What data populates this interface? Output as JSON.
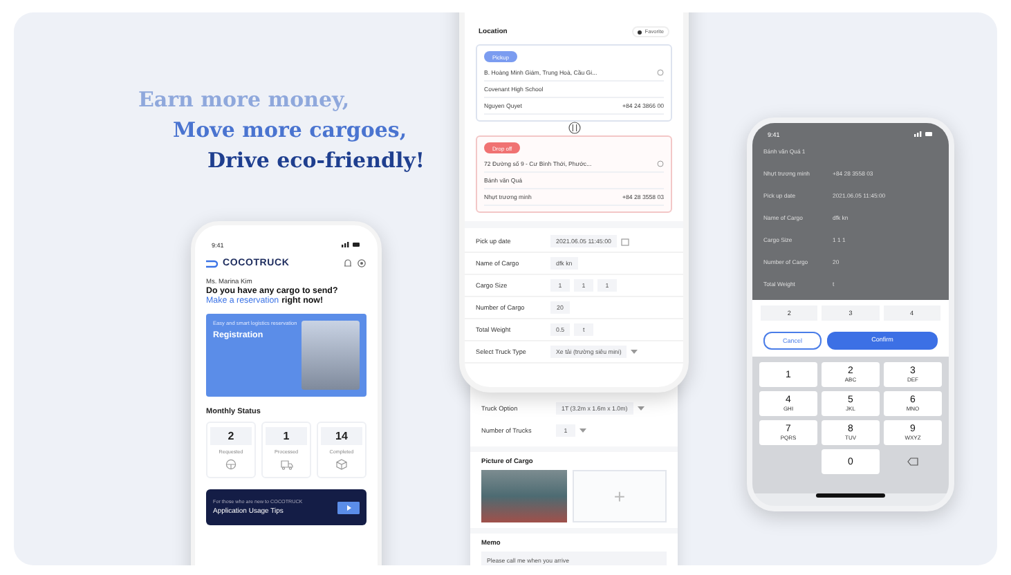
{
  "headline": [
    {
      "text": "Earn more money,",
      "color": "#8fa8dc"
    },
    {
      "text": "Move more cargoes,",
      "color": "#4a74d0"
    },
    {
      "text": "Drive eco-friendly!",
      "color": "#1f3f8f"
    }
  ],
  "home": {
    "time": "9:41",
    "brand": "COCOTRUCK",
    "greeting": "Ms. Marina Kim",
    "question": "Do you have any cargo to send?",
    "link": "Make a reservation",
    "link_rest": "right now!",
    "banner": {
      "caption": "Easy and smart logistics reservation",
      "title": "Registration"
    },
    "status_title": "Monthly Status",
    "status": [
      {
        "count": "2",
        "label": "Requested"
      },
      {
        "count": "1",
        "label": "Processed"
      },
      {
        "count": "14",
        "label": "Completed"
      }
    ],
    "tips": {
      "caption": "For those who are new to COCOTRUCK",
      "title": "Application Usage Tips"
    }
  },
  "order": {
    "section": "Location",
    "favorite": "Favorite",
    "stops": [
      {
        "kind": "pickup",
        "badge": "Pickup",
        "address": "B. Hoàng Minh Giám, Trung Hoà, Cầu Gi...",
        "place": "Covenant High School",
        "contact": "Nguyen Quyet",
        "phone": "+84 24 3866 00"
      },
      {
        "kind": "dropoff",
        "badge": "Drop off",
        "address": "72 Đường số 9 - Cư Bình Thới, Phước...",
        "place": "Bánh văn Quá",
        "contact": "Nhựt trương minh",
        "phone": "+84 28 3558 03"
      }
    ],
    "fields": [
      {
        "label": "Pick up date",
        "values": [
          "2021.06.05 11:45:00"
        ],
        "kind": "date"
      },
      {
        "label": "Name of Cargo",
        "values": [
          "dfk kn"
        ],
        "kind": "text"
      },
      {
        "label": "Cargo Size",
        "values": [
          "1",
          "1",
          "1"
        ],
        "kind": "text"
      },
      {
        "label": "Number of Cargo",
        "values": [
          "20"
        ],
        "kind": "text"
      },
      {
        "label": "Total Weight",
        "values": [
          "0.5",
          "t"
        ],
        "kind": "text"
      },
      {
        "label": "Select Truck Type",
        "values": [
          "Xe tải (trường siêu mini)"
        ],
        "kind": "select"
      }
    ]
  },
  "panel": {
    "fields": [
      {
        "label": "Truck Option",
        "values": [
          "1T (3.2m x 1.6m x 1.0m)"
        ],
        "kind": "select"
      },
      {
        "label": "Number of Trucks",
        "values": [
          "1"
        ],
        "kind": "select"
      }
    ],
    "picture_title": "Picture of Cargo",
    "add": "+",
    "memo_title": "Memo",
    "memo": "Please call me when you arrive"
  },
  "keypad": {
    "time": "9:41",
    "rows": [
      {
        "label": "Bánh văn Quá 1"
      },
      {
        "label": "Nhựt trương minh",
        "value": "+84 28 3558 03"
      },
      {
        "label": "Pick up date",
        "value": "2021.06.05 11:45:00"
      },
      {
        "label": "Name of Cargo",
        "value": "dfk kn"
      },
      {
        "label": "Cargo Size",
        "value": "1 1 1"
      },
      {
        "label": "Number of Cargo",
        "value": "20"
      },
      {
        "label": "Total Weight",
        "value": "t"
      }
    ],
    "picker": [
      "2",
      "3",
      "4"
    ],
    "cancel": "Cancel",
    "confirm": "Confirm",
    "keys": [
      {
        "kind": "digit",
        "digit": "1"
      },
      {
        "kind": "digit",
        "digit": "2",
        "letters": "ABC"
      },
      {
        "kind": "digit",
        "digit": "3",
        "letters": "DEF"
      },
      {
        "kind": "digit",
        "digit": "4",
        "letters": "GHI"
      },
      {
        "kind": "digit",
        "digit": "5",
        "letters": "JKL"
      },
      {
        "kind": "digit",
        "digit": "6",
        "letters": "MNO"
      },
      {
        "kind": "digit",
        "digit": "7",
        "letters": "PQRS"
      },
      {
        "kind": "digit",
        "digit": "8",
        "letters": "TUV"
      },
      {
        "kind": "digit",
        "digit": "9",
        "letters": "WXYZ"
      },
      {
        "kind": "blank"
      },
      {
        "kind": "digit",
        "digit": "0"
      },
      {
        "kind": "backspace"
      }
    ]
  }
}
